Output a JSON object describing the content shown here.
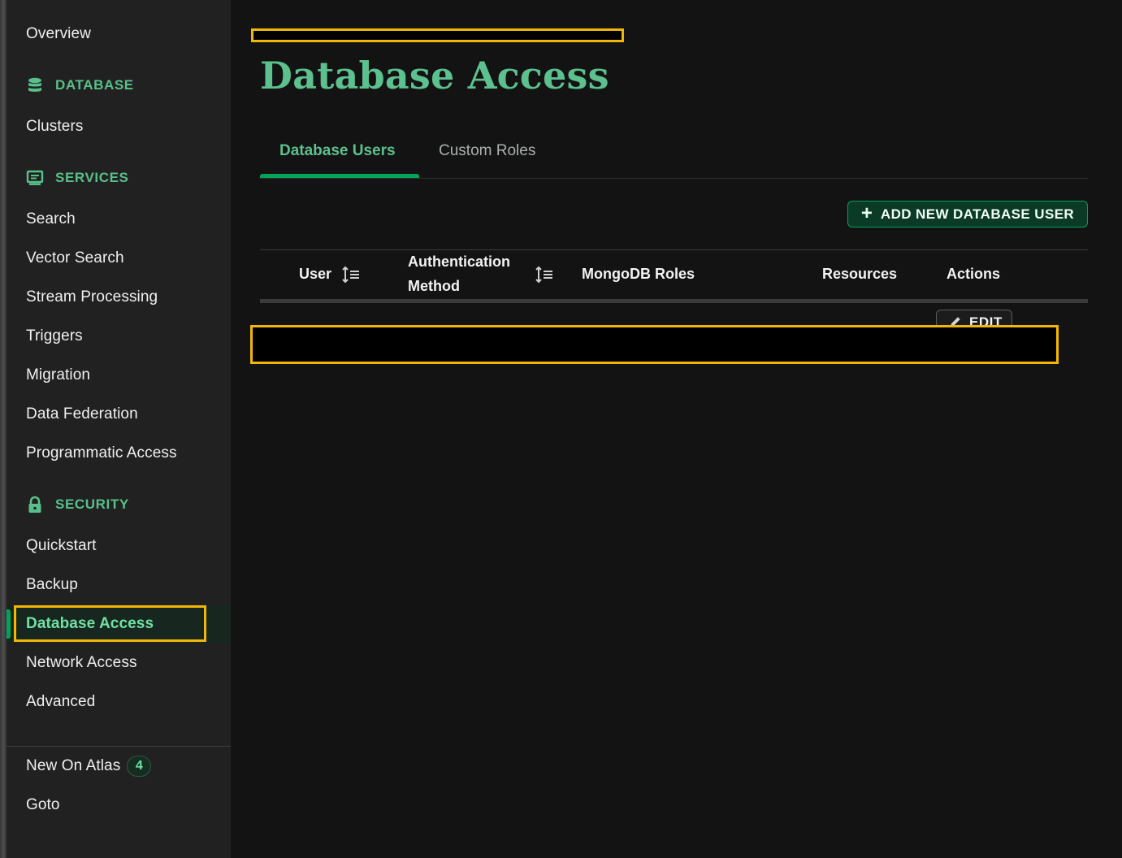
{
  "sidebar": {
    "overview": "Overview",
    "sections": [
      {
        "label": "DATABASE",
        "icon": "database-icon"
      },
      {
        "label": "SERVICES",
        "icon": "services-icon"
      },
      {
        "label": "SECURITY",
        "icon": "lock-icon"
      }
    ],
    "database_items": [
      "Clusters"
    ],
    "services_items": [
      "Search",
      "Vector Search",
      "Stream Processing",
      "Triggers",
      "Migration",
      "Data Federation",
      "Programmatic Access"
    ],
    "security_items": [
      "Quickstart",
      "Backup",
      "Database Access",
      "Network Access",
      "Advanced"
    ],
    "active_item": "Database Access",
    "footer": {
      "new_on_atlas": "New On Atlas",
      "new_on_atlas_count": "4",
      "goto": "Goto"
    }
  },
  "main": {
    "title": "Database Access",
    "tabs": [
      {
        "label": "Database Users",
        "active": true
      },
      {
        "label": "Custom Roles",
        "active": false
      }
    ],
    "add_button": "ADD NEW DATABASE USER",
    "table": {
      "headers": {
        "user": "User",
        "auth_line1": "Authentication",
        "auth_line2": "Method",
        "roles": "MongoDB Roles",
        "resources": "Resources",
        "actions": "Actions"
      },
      "edit_button": "EDIT"
    }
  },
  "colors": {
    "accent": "#00a35c",
    "accent_text": "#5cc18e",
    "highlight": "#f2b705",
    "background": "#131313",
    "sidebar_bg": "#212121"
  }
}
